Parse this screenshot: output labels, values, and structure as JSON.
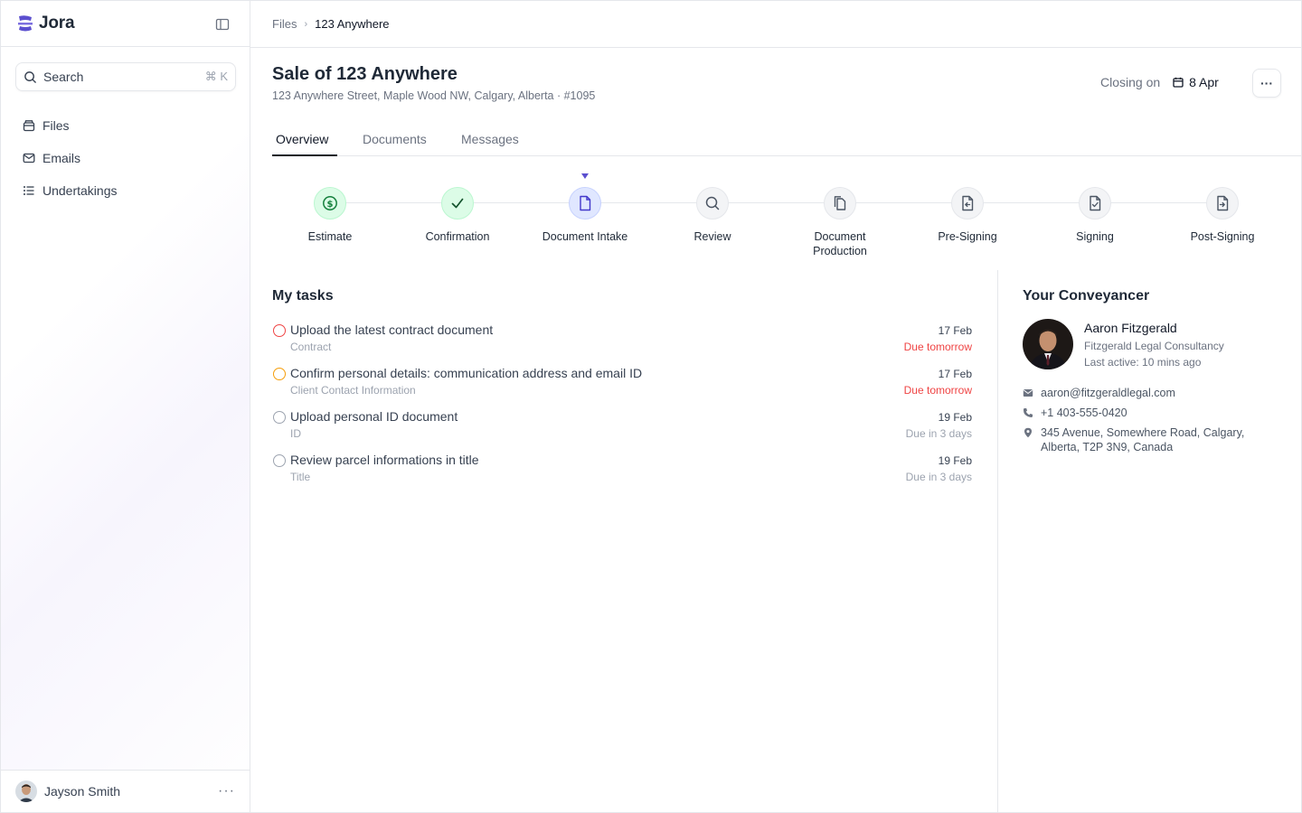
{
  "app": {
    "name": "Jora"
  },
  "sidebar": {
    "search": {
      "label": "Search",
      "shortcut": "⌘ K"
    },
    "items": [
      {
        "label": "Files",
        "icon": "archive-icon"
      },
      {
        "label": "Emails",
        "icon": "mail-icon"
      },
      {
        "label": "Undertakings",
        "icon": "list-icon"
      }
    ],
    "user": {
      "name": "Jayson Smith",
      "more": "···"
    }
  },
  "breadcrumb": {
    "parent": "Files",
    "current": "123 Anywhere"
  },
  "file": {
    "title": "Sale of 123 Anywhere",
    "subtitle": "123 Anywhere Street, Maple Wood NW, Calgary, Alberta · #1095",
    "closing_label": "Closing on",
    "closing_date": "8 Apr",
    "more": "···"
  },
  "tabs": [
    {
      "label": "Overview",
      "active": true
    },
    {
      "label": "Documents",
      "active": false
    },
    {
      "label": "Messages",
      "active": false
    }
  ],
  "steps": [
    {
      "label": "Estimate",
      "state": "done",
      "icon": "dollar-circle-icon"
    },
    {
      "label": "Confirmation",
      "state": "done",
      "icon": "check-icon"
    },
    {
      "label": "Document Intake",
      "state": "current",
      "icon": "document-icon"
    },
    {
      "label": "Review",
      "state": "pending",
      "icon": "search-icon"
    },
    {
      "label": "Document Production",
      "state": "pending",
      "icon": "documents-stack-icon"
    },
    {
      "label": "Pre-Signing",
      "state": "pending",
      "icon": "document-arrow-icon"
    },
    {
      "label": "Signing",
      "state": "pending",
      "icon": "document-check-icon"
    },
    {
      "label": "Post-Signing",
      "state": "pending",
      "icon": "document-forward-icon"
    }
  ],
  "tasks": {
    "title": "My tasks",
    "items": [
      {
        "title": "Upload the latest contract document",
        "category": "Contract",
        "date": "17 Feb",
        "due": "Due tomorrow",
        "status_color": "#ef4444",
        "due_color": "#ef4444"
      },
      {
        "title": "Confirm personal details: communication address and email ID",
        "category": "Client Contact Information",
        "date": "17 Feb",
        "due": "Due tomorrow",
        "status_color": "#f59e0b",
        "due_color": "#ef4444"
      },
      {
        "title": "Upload personal ID document",
        "category": "ID",
        "date": "19 Feb",
        "due": "Due in 3 days",
        "status_color": "#9ca3af",
        "due_color": "#9ca3af"
      },
      {
        "title": "Review parcel informations in title",
        "category": "Title",
        "date": "19 Feb",
        "due": "Due in 3 days",
        "status_color": "#9ca3af",
        "due_color": "#9ca3af"
      }
    ]
  },
  "conveyancer": {
    "title": "Your Conveyancer",
    "name": "Aaron Fitzgerald",
    "firm": "Fitzgerald Legal Consultancy",
    "last_active": "Last active: 10 mins ago",
    "email": "aaron@fitzgeraldlegal.com",
    "phone": "+1 403-555-0420",
    "address": "345 Avenue, Somewhere Road, Calgary, Alberta, T2P 3N9, Canada"
  },
  "colors": {
    "accent": "#5b4fcf",
    "done": "#16a34a",
    "danger": "#ef4444",
    "warning": "#f59e0b"
  }
}
